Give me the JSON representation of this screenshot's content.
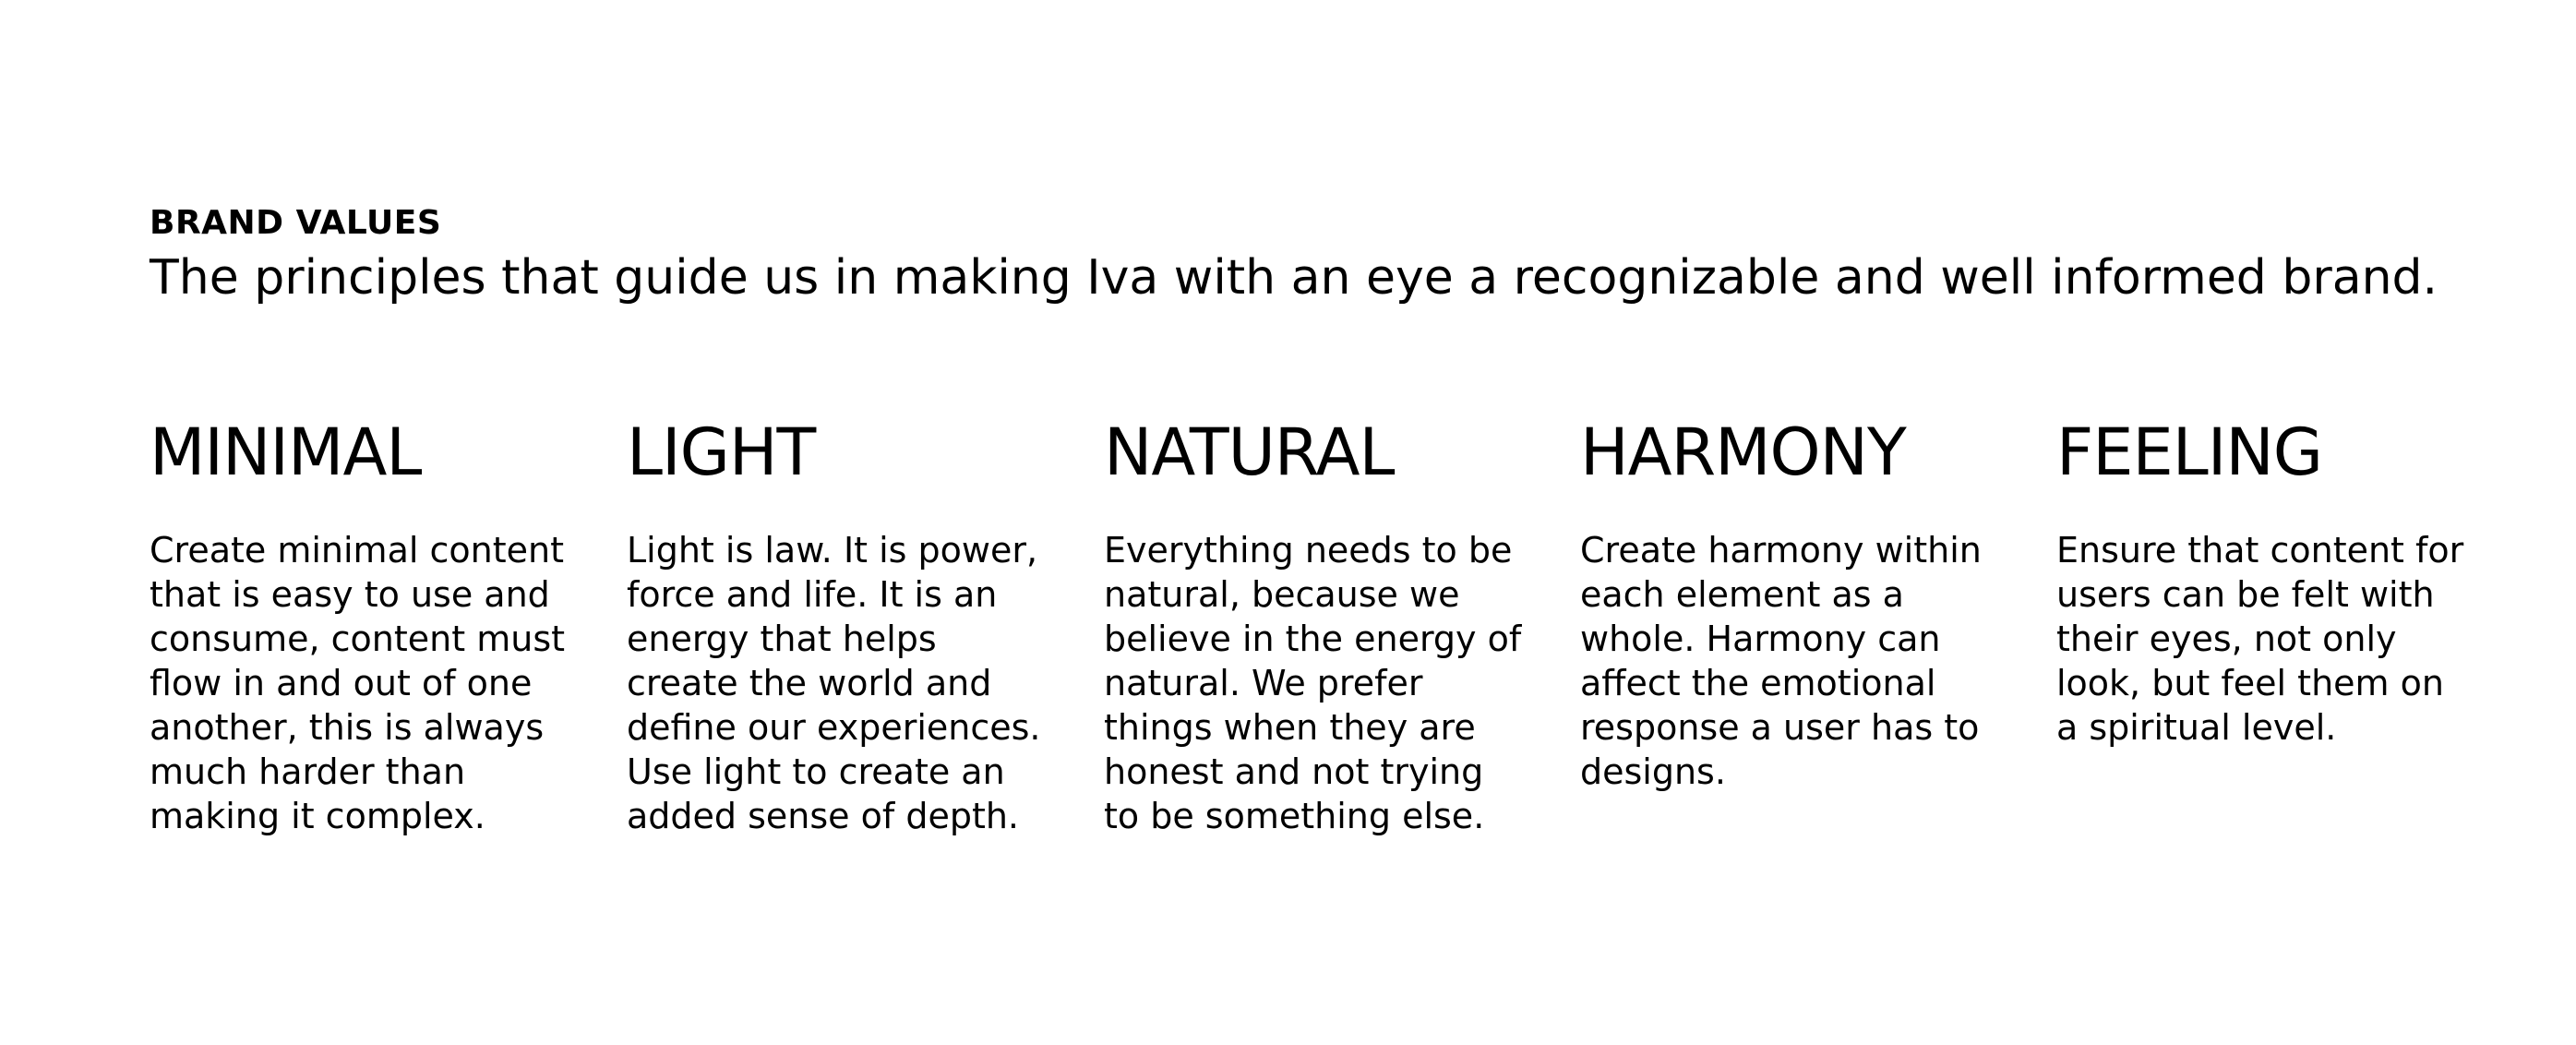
{
  "header": {
    "eyebrow": "BRAND VALUES",
    "subtitle": "The principles that guide us in making Iva with an eye a recognizable and well informed brand."
  },
  "values": [
    {
      "title": "MINIMAL",
      "text": "Create minimal content\nthat is easy to use and\nconsume, content must\nflow in and out of one\nanother, this is always\nmuch harder than\nmaking it complex."
    },
    {
      "title": "LIGHT",
      "text": "Light is law. It is power,\nforce and life. It is an\nenergy that helps\ncreate the world and\ndefine our experiences.\nUse light to create an\nadded sense of depth."
    },
    {
      "title": "NATURAL",
      "text": "Everything needs to be\nnatural, because we\nbelieve in the energy of\nnatural. We prefer\nthings when they are\nhonest and not trying\nto be something else."
    },
    {
      "title": "HARMONY",
      "text": "Create harmony within\neach element as a\nwhole. Harmony can\naffect the emotional\nresponse a user has to\ndesigns."
    },
    {
      "title": "FEELING",
      "text": "Ensure that content for\nusers can be felt with\ntheir eyes, not only\nlook, but feel them on\na spiritual level."
    }
  ],
  "colors": {
    "background": "#ffffff",
    "text": "#000000"
  }
}
